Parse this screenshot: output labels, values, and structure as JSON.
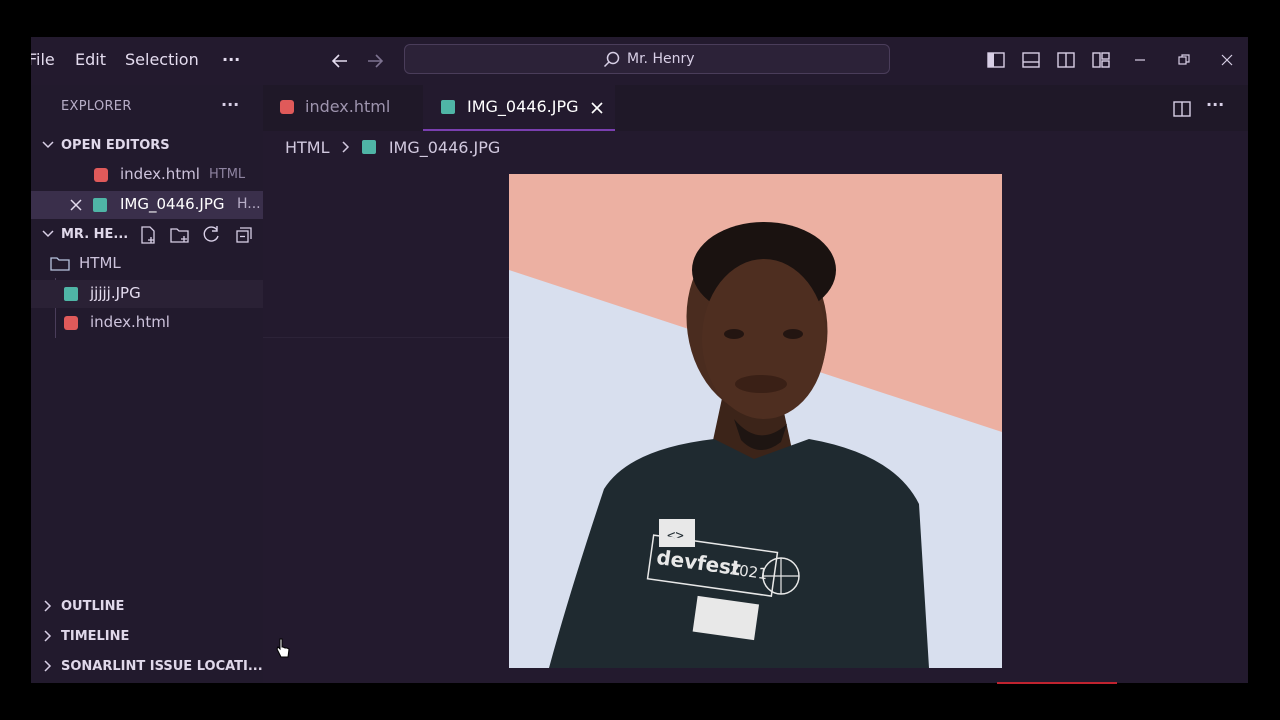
{
  "menu": {
    "file": "File",
    "edit": "Edit",
    "selection": "Selection",
    "more": "···"
  },
  "command_center": {
    "label": "Mr. Henry"
  },
  "sidebar": {
    "title": "EXPLORER",
    "more": "···",
    "open_editors": {
      "title": "OPEN EDITORS",
      "items": [
        {
          "name": "index.html",
          "suffix": "HTML"
        },
        {
          "name": "IMG_0446.JPG",
          "suffix": "H..."
        }
      ]
    },
    "workspace": {
      "title": "MR. HE...",
      "folder": "HTML",
      "files": [
        "jjjjj.JPG",
        "index.html"
      ]
    },
    "outline": "OUTLINE",
    "timeline": "TIMELINE",
    "sonarlint": "SONARLINT ISSUE LOCATI..."
  },
  "tabs": [
    {
      "label": "index.html",
      "icon": "html-file-icon"
    },
    {
      "label": "IMG_0446.JPG",
      "icon": "image-file-icon"
    }
  ],
  "breadcrumb": {
    "folder": "HTML",
    "file": "IMG_0446.JPG"
  },
  "shirt_text": {
    "code": "<>",
    "line": "devfest",
    "year": "2021"
  },
  "colors": {
    "background": "#231a2e",
    "sidebar": "#221a2d",
    "selected_row": "#3a2f4b",
    "active_tab_border": "#7a3fb0",
    "html_icon": "#e05a5a",
    "image_icon": "#4fb5a6"
  }
}
